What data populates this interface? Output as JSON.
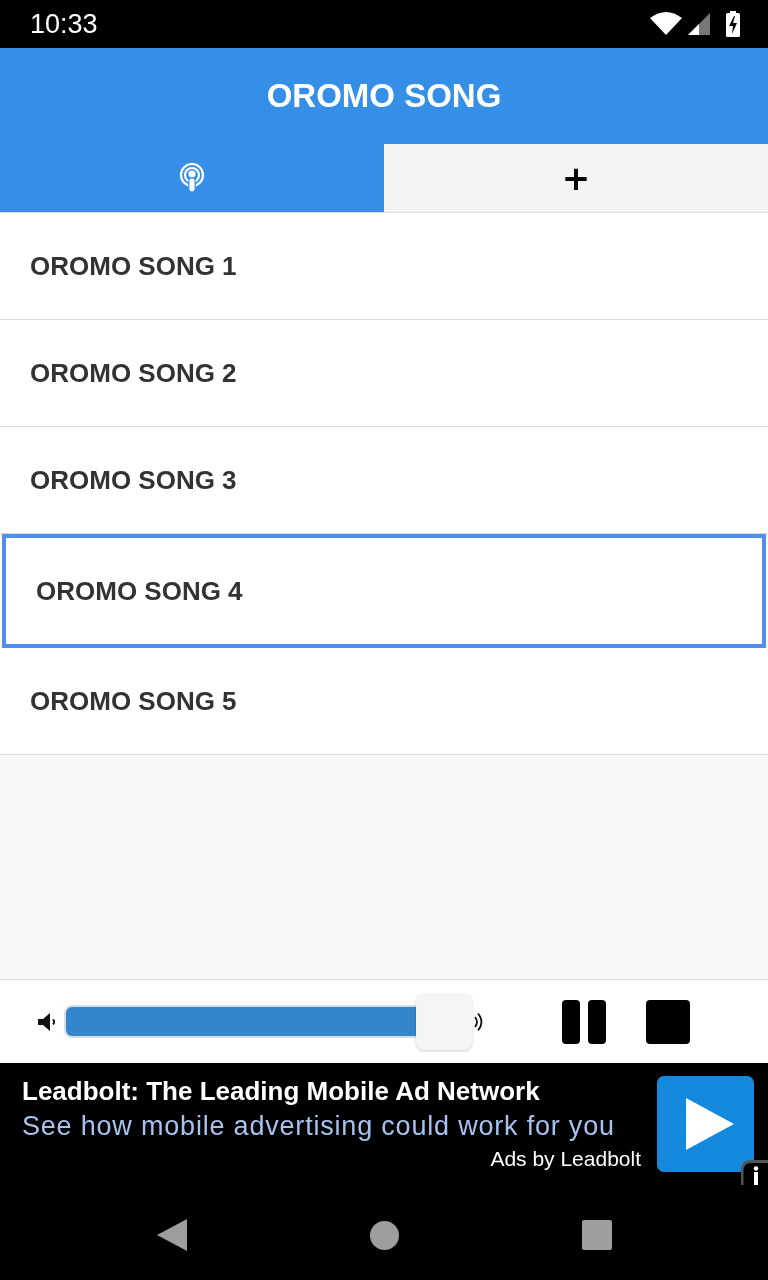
{
  "status_bar": {
    "time": "10:33"
  },
  "app_bar": {
    "title": "OROMO SONG"
  },
  "tabs": [
    {
      "kind": "icon",
      "selected": true
    },
    {
      "kind": "text",
      "label": "+",
      "selected": false
    }
  ],
  "songs": [
    {
      "title": "OROMO SONG 1",
      "selected": false
    },
    {
      "title": "OROMO SONG 2",
      "selected": false
    },
    {
      "title": "OROMO SONG 3",
      "selected": false
    },
    {
      "title": "OROMO SONG 4",
      "selected": true
    },
    {
      "title": "OROMO SONG 5",
      "selected": false
    }
  ],
  "player": {
    "volume": {
      "level": 0.936
    },
    "controls": [
      {
        "kind": "pause"
      },
      {
        "kind": "stop"
      }
    ]
  },
  "ad": {
    "headline": "Leadbolt: The Leading Mobile Ad Network",
    "text": "See how mobile advertising could work for you",
    "attribution": "Ads by Leadbolt"
  }
}
